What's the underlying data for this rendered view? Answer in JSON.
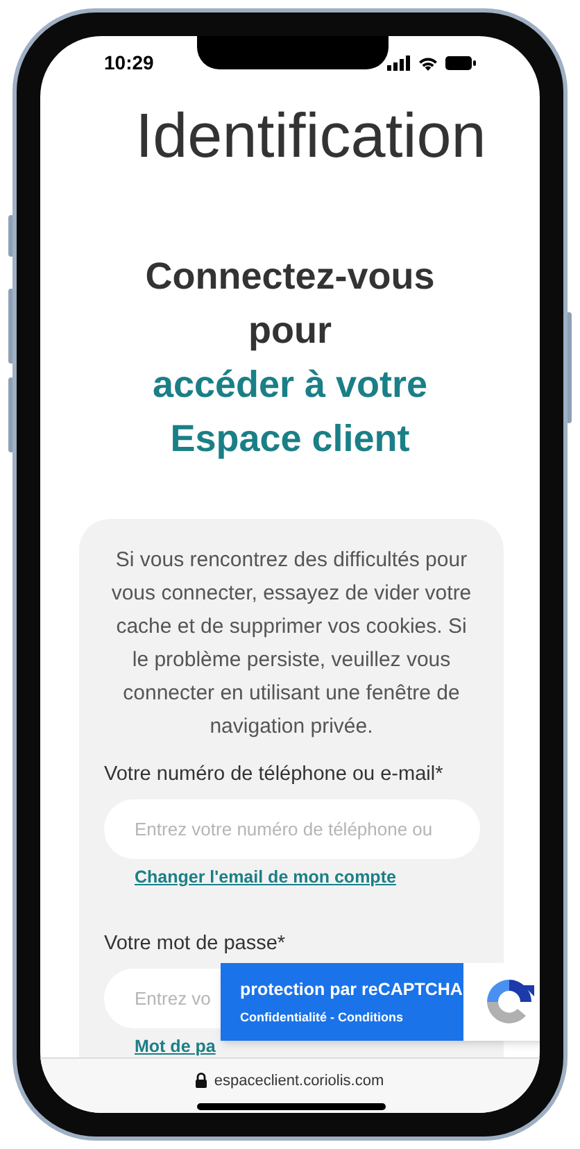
{
  "status_bar": {
    "time": "10:29"
  },
  "title": "Identification",
  "heading": {
    "lines": [
      "Connectez-vous",
      "pour"
    ],
    "accent_lines": [
      "accéder à votre",
      "Espace client"
    ]
  },
  "card": {
    "notice": "Si vous rencontrez des difficultés pour vous connecter, essayez de vider votre cache et de supprimer vos cookies. Si le problème persiste, veuillez vous connecter en utilisant une fenêtre de navigation privée.",
    "fields": [
      {
        "label": "Votre numéro de téléphone ou e-mail*",
        "placeholder": "Entrez votre numéro de téléphone ou",
        "link": "Changer l'email de mon compte"
      },
      {
        "label": "Votre mot de passe*",
        "placeholder": "Entrez vo",
        "link": "Mot de pa"
      }
    ]
  },
  "recaptcha": {
    "title": "protection par reCAPTCHA",
    "links": "Confidentialité - Conditions"
  },
  "browser_bar": {
    "url": "espaceclient.coriolis.com"
  }
}
